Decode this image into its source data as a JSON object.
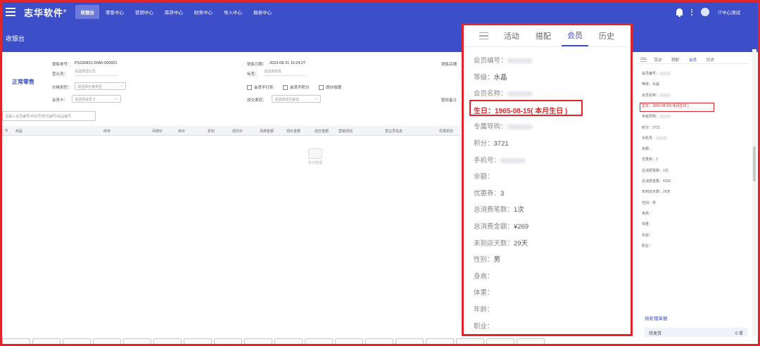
{
  "topnav": {
    "brand": "志华软件",
    "brand_mark": "®",
    "items": [
      "收银台",
      "零售中心",
      "营销中心",
      "库存中心",
      "财务中心",
      "导入中心",
      "报表中心"
    ],
    "active_index": 0,
    "username": "IT中心测试"
  },
  "page": {
    "title": "收银台"
  },
  "form": {
    "sale_type": "正常零售",
    "sale_no_label": "销售单号：",
    "sale_no": "PS230831-00A0-000001",
    "sale_date_label": "销售日期：",
    "sale_date": "2023-08-31 16:24:27",
    "sales_clerk_label": "销售店铺",
    "business_label": "营业员：",
    "business_placeholder": "请选择营业员",
    "tag_label": "标签：",
    "tag_placeholder": "请选择标签",
    "price_type_label": "价格类型：",
    "price_type_placeholder": "请选择价格类型",
    "member_card_label": "会员卡：",
    "member_card_placeholder": "请选择会员卡",
    "checkbox_no_print": "会员不打折",
    "checkbox_no_points": "会员不积分",
    "checkbox_original": "原价收银",
    "deal_source_label": "成交渠道：",
    "deal_source_placeholder": "请选择成交渠道",
    "remark_label": "暂挂备注",
    "search_placeholder": "请输入会员编号/手机号/款式编号/货品编号"
  },
  "table": {
    "columns": [
      "商品",
      "库存",
      "吊牌价",
      "单价",
      "折扣",
      "成交价",
      "吊牌金额",
      "现价金额",
      "成交金额",
      "营销活动",
      "营业员信息",
      "优惠折扣"
    ],
    "empty_text": "暂无数据"
  },
  "member_panel": {
    "tabs": [
      "活动",
      "搭配",
      "会员",
      "历史"
    ],
    "active_tab": 2,
    "rows": [
      {
        "label": "会员编号：",
        "value": "",
        "blurred": true
      },
      {
        "label": "等级：",
        "value": "水晶",
        "blurred": false
      },
      {
        "label": "会员名称：",
        "value": "",
        "blurred": true
      },
      {
        "label": "生日：",
        "value": "1965-08-15( 本月生日 )",
        "blurred": false,
        "highlight": true
      },
      {
        "label": "专属导购：",
        "value": "",
        "blurred": true
      },
      {
        "label": "积分：",
        "value": "3721",
        "blurred": false
      },
      {
        "label": "手机号：",
        "value": "",
        "blurred": true
      },
      {
        "label": "余额：",
        "value": "",
        "blurred": false
      },
      {
        "label": "优惠券：",
        "value": "3",
        "blurred": false
      },
      {
        "label": "总消费笔数：",
        "value": "1次",
        "blurred": false
      },
      {
        "label": "总消费金额：",
        "value": "¥269",
        "blurred": false
      },
      {
        "label": "未到店天数：",
        "value": "29天",
        "blurred": false
      },
      {
        "label": "性别：",
        "value": "男",
        "blurred": false
      },
      {
        "label": "身高：",
        "value": "",
        "blurred": false
      },
      {
        "label": "体重：",
        "value": "",
        "blurred": false
      },
      {
        "label": "年龄：",
        "value": "",
        "blurred": false
      },
      {
        "label": "职业：",
        "value": "",
        "blurred": false
      }
    ]
  },
  "small_panel": {
    "rows": [
      {
        "label": "会员编号：",
        "value": ""
      },
      {
        "label": "等级：",
        "value": "水晶"
      },
      {
        "label": "会员名称：",
        "value": ""
      },
      {
        "label": "生日：",
        "value": "1965-08-15( 本月生日 )"
      },
      {
        "label": "专属导购：",
        "value": ""
      },
      {
        "label": "积分：",
        "value": "3721"
      },
      {
        "label": "手机号：",
        "value": ""
      },
      {
        "label": "余额：",
        "value": ""
      },
      {
        "label": "优惠券：",
        "value": "3"
      },
      {
        "label": "总消费笔数：",
        "value": "1次"
      },
      {
        "label": "总消费金额：",
        "value": "¥269"
      },
      {
        "label": "未到店天数：",
        "value": "29天"
      },
      {
        "label": "性别：",
        "value": "男"
      },
      {
        "label": "身高：",
        "value": ""
      },
      {
        "label": "体重：",
        "value": ""
      },
      {
        "label": "年龄：",
        "value": ""
      },
      {
        "label": "职业：",
        "value": ""
      }
    ]
  },
  "pending": {
    "title": "待处理单据",
    "row_label": "待发货",
    "row_count": "0 单"
  },
  "colors": {
    "primary": "#3d4fc8",
    "highlight": "#e0262a"
  }
}
